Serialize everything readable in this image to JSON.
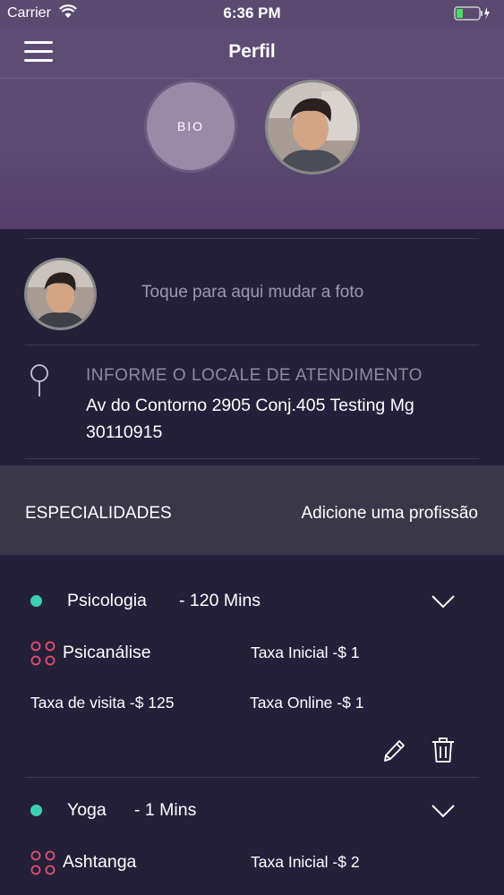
{
  "status_bar": {
    "carrier": "Carrier",
    "time": "6:36 PM"
  },
  "header": {
    "title": "Perfil",
    "bio_label": "BIO"
  },
  "profile": {
    "photo_hint": "Toque para aqui mudar a foto"
  },
  "location": {
    "label": "INFORME O LOCALE DE ATENDIMENTO",
    "address": "Av do Contorno 2905 Conj.405  Testing Mg 30110915"
  },
  "specialties": {
    "title": "ESPECIALIDADES",
    "add_label": "Adicione uma profissão",
    "items": [
      {
        "name": "Psicologia",
        "duration": "- 120 Mins",
        "sub_name": "Psicanálise",
        "initial_fee": "Taxa Inicial -$ 1",
        "visit_fee": "Taxa de visita -$ 125",
        "online_fee": "Taxa Online -$ 1"
      },
      {
        "name": "Yoga",
        "duration": "- 1 Mins",
        "sub_name": "Ashtanga",
        "initial_fee": "Taxa Inicial -$ 2"
      }
    ]
  },
  "icons": {
    "menu": "hamburger-icon",
    "wifi": "wifi-icon",
    "battery": "battery-icon",
    "location": "pin-icon",
    "expand": "chevron-down-icon",
    "sub_specialty": "four-dots-icon",
    "edit": "pencil-icon",
    "delete": "trash-icon"
  },
  "colors": {
    "header_bg": "#5b4a72",
    "body_bg": "#24203a",
    "accent_dot": "#3ecfb0",
    "sub_icon": "#e0506e"
  }
}
